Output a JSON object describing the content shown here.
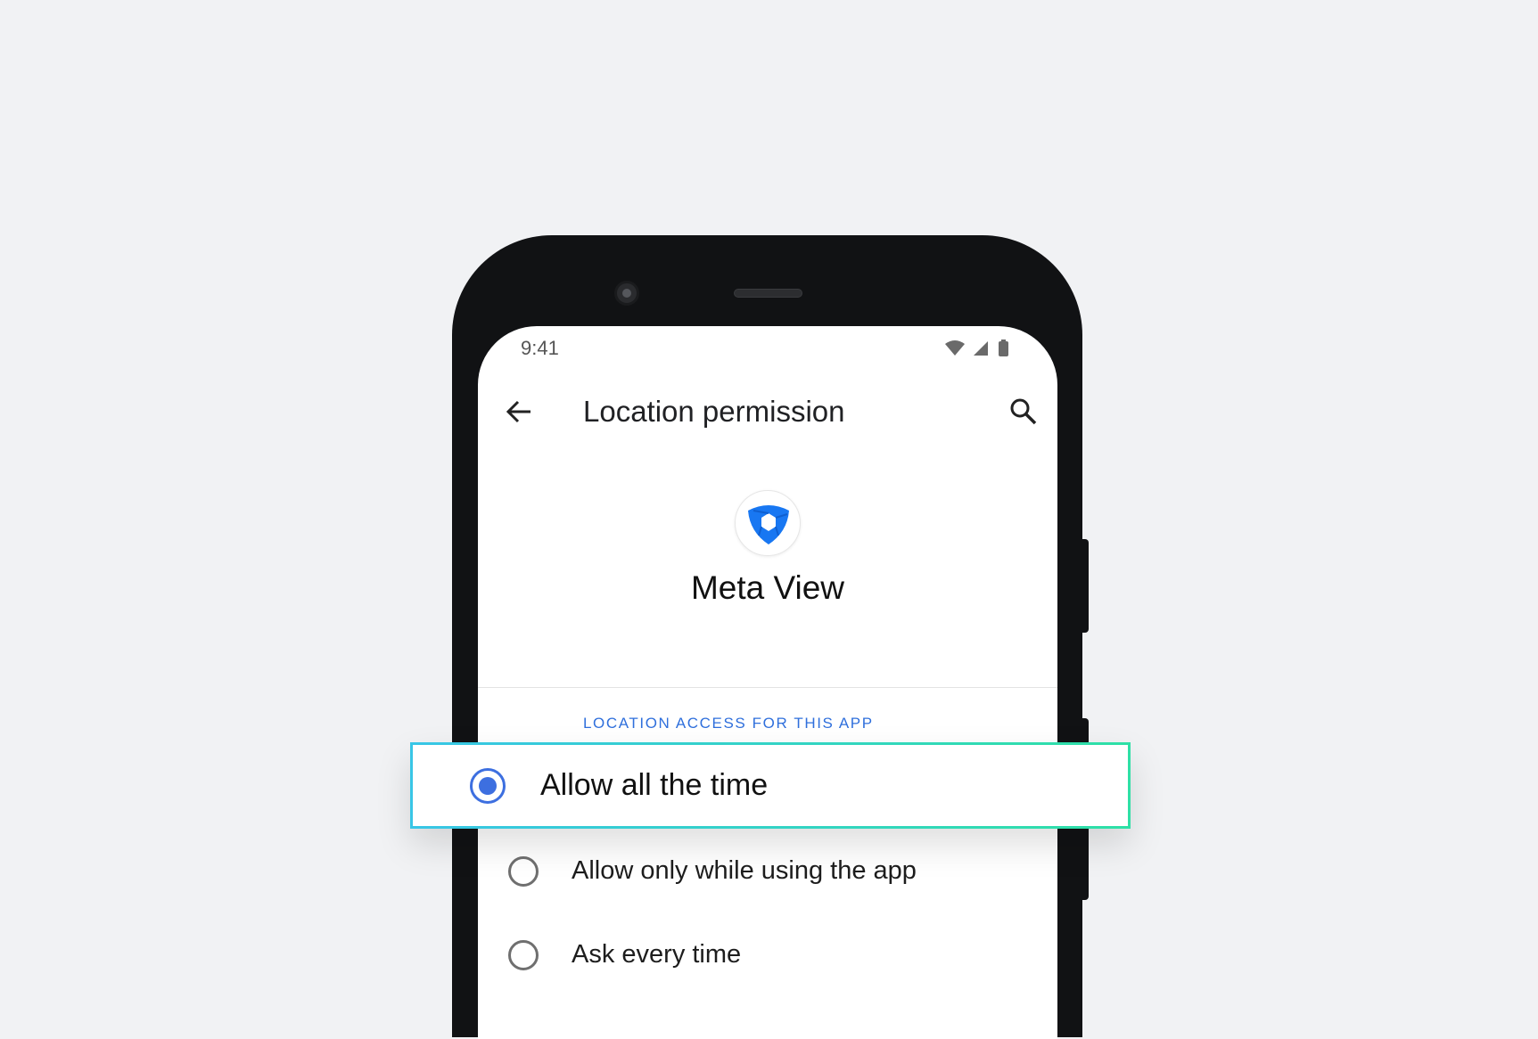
{
  "status_bar": {
    "time": "9:41",
    "icons": [
      "wifi-icon",
      "signal-icon",
      "battery-icon"
    ]
  },
  "app_bar": {
    "title": "Location permission",
    "back_icon": "arrow-back-icon",
    "search_icon": "search-icon"
  },
  "app": {
    "name": "Meta View",
    "icon": "meta-view-logo",
    "brand_color": "#1877f2"
  },
  "section": {
    "label": "LOCATION ACCESS FOR THIS APP",
    "color": "#2f6fdc"
  },
  "options": [
    {
      "label": "Allow all the time",
      "selected": true
    },
    {
      "label": "Allow only while using the app",
      "selected": false
    },
    {
      "label": "Ask every time",
      "selected": false
    }
  ]
}
